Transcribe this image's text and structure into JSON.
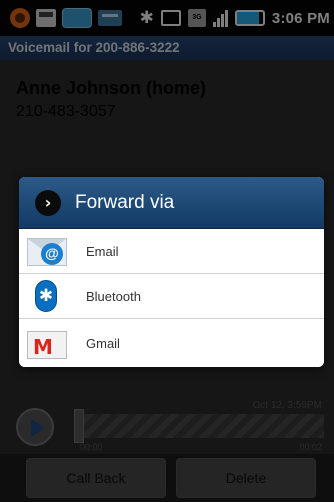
{
  "status_bar": {
    "time": "3:06 PM",
    "battery_level_pct": 0.85,
    "signal_bars": 4,
    "bluetooth_glyph": "✱",
    "left_icons": [
      "app-icon",
      "sd-card-icon",
      "battery-indicator-icon",
      "usb-icon"
    ],
    "right_icons": [
      "bluetooth-icon",
      "vibrate-icon",
      "3g-icon",
      "signal-icon",
      "battery-icon"
    ]
  },
  "title_bar": {
    "text": "Voicemail for 200-886-3222"
  },
  "contact": {
    "name": "Anne  Johnson (home)",
    "phone": "210-483-3057"
  },
  "player": {
    "date": "Oct 12, 3:59PM",
    "time_start": "00:00",
    "time_end": "00:02"
  },
  "actions": {
    "call_back": "Call Back",
    "delete": "Delete"
  },
  "dialog": {
    "title": "Forward via",
    "title_icon": "›",
    "options": [
      {
        "label": "Email",
        "icon": "email-icon"
      },
      {
        "label": "Bluetooth",
        "icon": "bluetooth-icon"
      },
      {
        "label": "Gmail",
        "icon": "gmail-icon"
      }
    ]
  },
  "colors": {
    "title_bar": "#1b3660",
    "dialog_header": "#123a65",
    "battery_fill": "#2bb3f0",
    "gmail_red": "#d8261d",
    "bluetooth_blue": "#0a6fc1"
  }
}
